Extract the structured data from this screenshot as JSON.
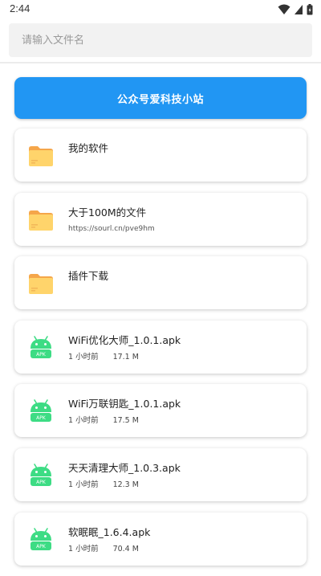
{
  "status_bar": {
    "time": "2:44",
    "icons": [
      "wifi-icon",
      "signal-icon",
      "battery-icon"
    ]
  },
  "search": {
    "placeholder": "请输入文件名",
    "value": ""
  },
  "banner": {
    "label": "公众号爱科技小站",
    "color": "#2196f3"
  },
  "items": [
    {
      "icon": "folder-icon",
      "name": "我的软件"
    },
    {
      "icon": "folder-icon",
      "name": "大于100M的文件",
      "subtitle": "https://sourl.cn/pve9hm"
    },
    {
      "icon": "folder-icon",
      "name": "插件下载"
    },
    {
      "icon": "apk-android-icon",
      "name": "WiFi优化大师_1.0.1.apk",
      "time": "1 小时前",
      "size": "17.1 M"
    },
    {
      "icon": "apk-android-icon",
      "name": "WiFi万联钥匙_1.0.1.apk",
      "time": "1 小时前",
      "size": "17.5 M"
    },
    {
      "icon": "apk-android-icon",
      "name": "天天清理大师_1.0.3.apk",
      "time": "1 小时前",
      "size": "12.3 M"
    },
    {
      "icon": "apk-android-icon",
      "name": "软眠眠_1.6.4.apk",
      "time": "1 小时前",
      "size": "70.4 M"
    }
  ],
  "apk_badge_text": "APK",
  "colors": {
    "folder": "#ffd46b",
    "folder_tab": "#f5a64a",
    "apk": "#3ddc84"
  }
}
